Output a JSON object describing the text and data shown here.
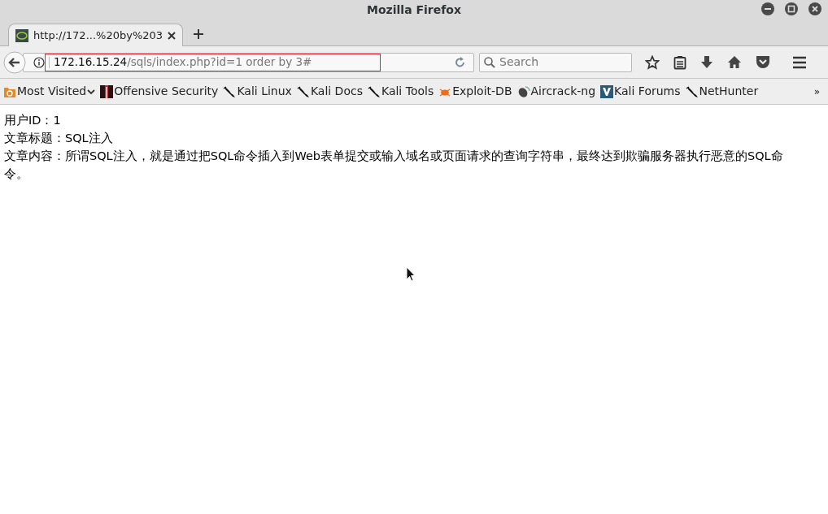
{
  "window": {
    "title": "Mozilla Firefox"
  },
  "tabs": [
    {
      "label": "http://172...%20by%203",
      "selected": true
    }
  ],
  "address_bar": {
    "host": "172.16.15.24",
    "path": "/sqls/index.php?id=1 order by 3#",
    "highlighted": true
  },
  "search": {
    "placeholder": "Search"
  },
  "bookmarks": [
    {
      "label": "Most Visited",
      "kind": "folder"
    },
    {
      "label": "Offensive Security",
      "kind": "offsec"
    },
    {
      "label": "Kali Linux",
      "kind": "kali"
    },
    {
      "label": "Kali Docs",
      "kind": "kali"
    },
    {
      "label": "Kali Tools",
      "kind": "kali"
    },
    {
      "label": "Exploit-DB",
      "kind": "exploit"
    },
    {
      "label": "Aircrack-ng",
      "kind": "aircrack"
    },
    {
      "label": "Kali Forums",
      "kind": "forums"
    },
    {
      "label": "NetHunter",
      "kind": "kali"
    }
  ],
  "overflow": "»",
  "content": {
    "lines": [
      "用户ID：1",
      "文章标题：SQL注入",
      "文章内容：所谓SQL注入，就是通过把SQL命令插入到Web表单提交或输入域名或页面请求的查询字符串，最终达到欺骗服务器执行恶意的SQL命令。"
    ]
  }
}
